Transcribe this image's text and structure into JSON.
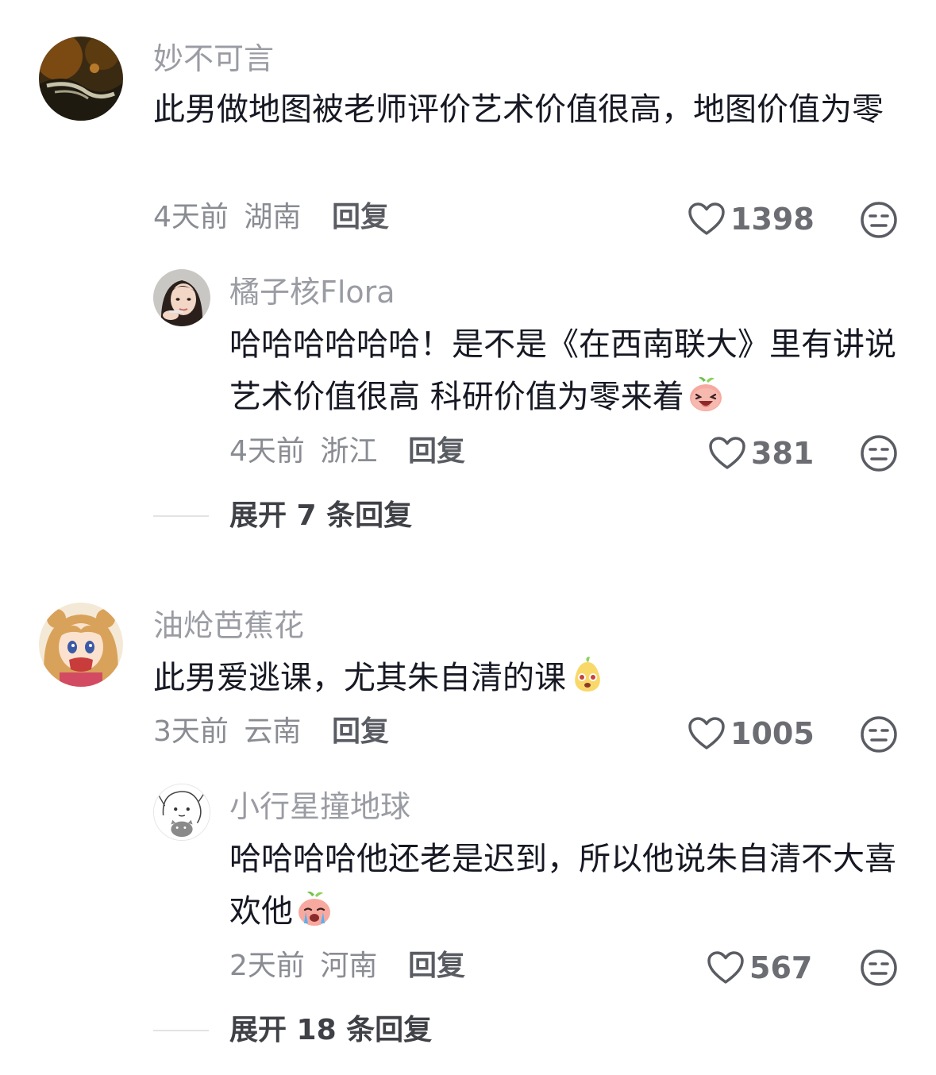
{
  "comments": [
    {
      "username": "妙不可言",
      "text": "此男做地图被老师评价艺术价值很高，地图价值为零",
      "time": "4天前",
      "location": "湖南",
      "reply_label": "回复",
      "likes": "1398",
      "avatar_icon": "landscape-avatar",
      "replies": [
        {
          "username": "橘子核Flora",
          "text": "哈哈哈哈哈哈！是不是《在西南联大》里有讲说艺术价值很高 科研价值为零来着",
          "emoji_icon": "laughing-peach-emoji",
          "time": "4天前",
          "location": "浙江",
          "reply_label": "回复",
          "likes": "381"
        }
      ],
      "expand_label": "展开 7 条回复"
    },
    {
      "username": "油炝芭蕉花",
      "text": "此男爱逃课，尤其朱自清的课",
      "emoji_icon": "peeking-pear-emoji",
      "time": "3天前",
      "location": "云南",
      "reply_label": "回复",
      "likes": "1005",
      "avatar_icon": "anime-girl-avatar",
      "replies": [
        {
          "username": "小行星撞地球",
          "text": "哈哈哈哈他还老是迟到，所以他说朱自清不大喜欢他",
          "emoji_icon": "crying-peach-emoji",
          "time": "2天前",
          "location": "河南",
          "reply_label": "回复",
          "likes": "567"
        }
      ],
      "expand_label": "展开 18 条回复"
    }
  ],
  "colors": {
    "username": "#9a9ca3",
    "text": "#161823",
    "meta": "#8a8c93"
  }
}
